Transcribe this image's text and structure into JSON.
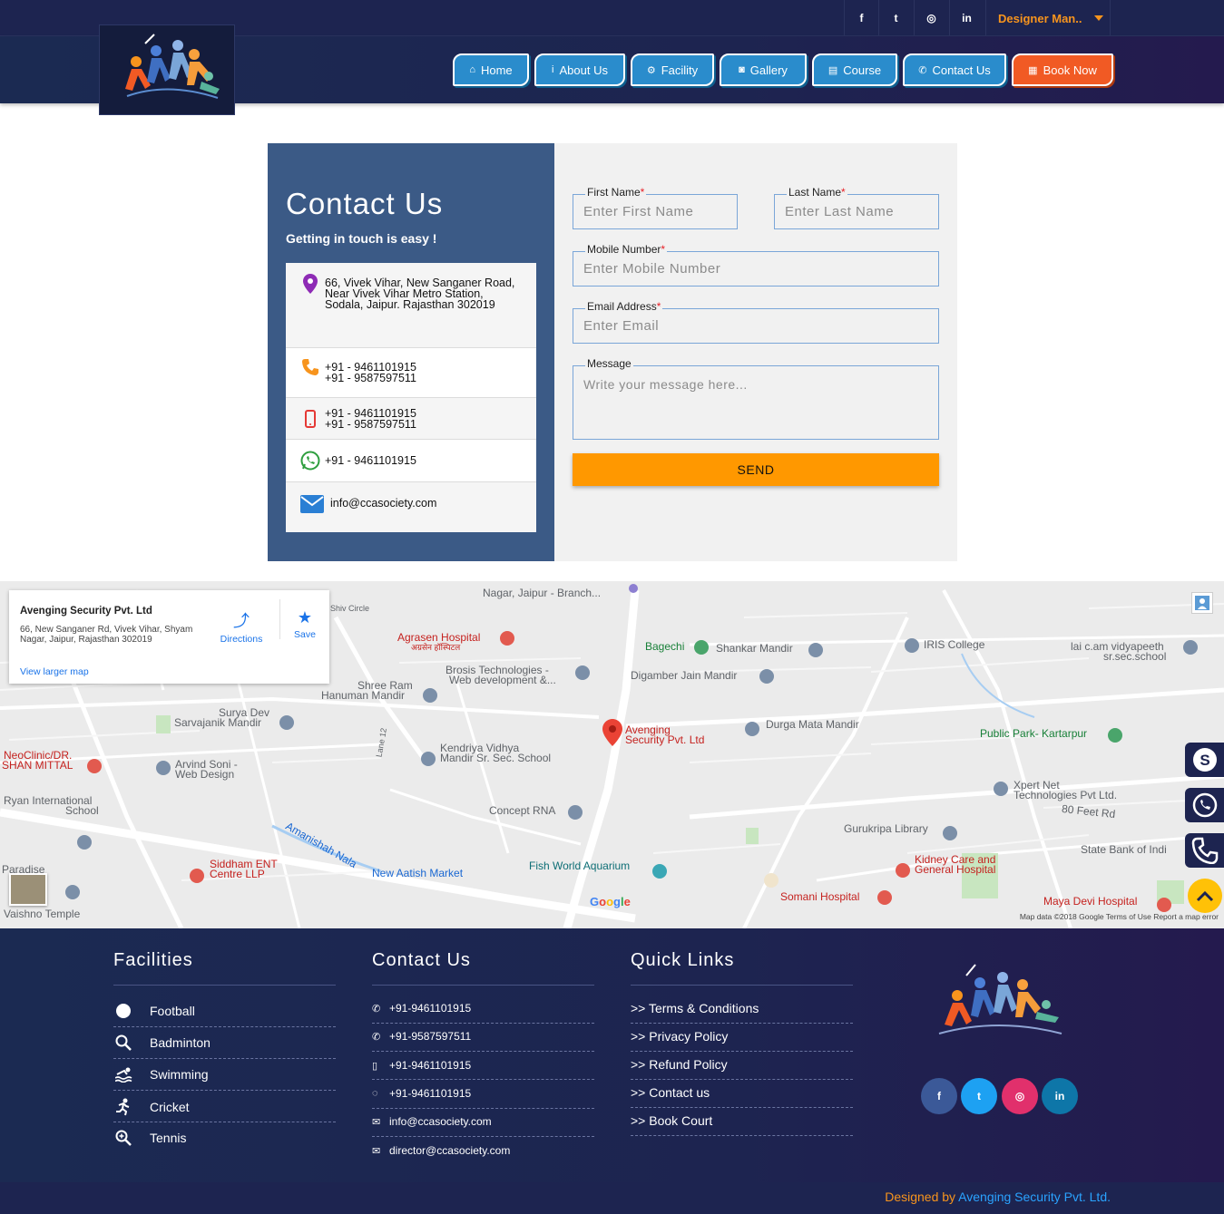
{
  "header": {
    "social": [
      {
        "name": "facebook",
        "glyph": "f"
      },
      {
        "name": "twitter",
        "glyph": "t"
      },
      {
        "name": "instagram",
        "glyph": "◎"
      },
      {
        "name": "linkedin",
        "glyph": "in"
      }
    ],
    "language": "Designer Man..",
    "nav": [
      {
        "label": "Home",
        "icon": "home-icon",
        "glyph": "⌂"
      },
      {
        "label": "About Us",
        "icon": "info-icon",
        "glyph": "i"
      },
      {
        "label": "Facility",
        "icon": "gears-icon",
        "glyph": "⚙"
      },
      {
        "label": "Gallery",
        "icon": "camera-icon",
        "glyph": "◙"
      },
      {
        "label": "Course",
        "icon": "book-icon",
        "glyph": "▤"
      },
      {
        "label": "Contact Us",
        "icon": "phone-icon",
        "glyph": "✆"
      },
      {
        "label": "Book Now",
        "icon": "calendar-check-icon",
        "glyph": "▦"
      }
    ],
    "colors": {
      "nav_blue": "#2a8ccc",
      "book_orange": "#f15a24",
      "dark_navy": "#1d2450"
    }
  },
  "contact_panel": {
    "title": "Contact Us",
    "subtitle": "Getting in touch is easy !",
    "address": [
      "66, Vivek Vihar, New Sanganer Road,",
      "Near Vivek Vihar Metro Station,",
      "Sodala, Jaipur. Rajasthan 302019"
    ],
    "phones": [
      "+91 - 9461101915",
      "+91 - 9587597511"
    ],
    "mobiles": [
      "+91 - 9461101915",
      "+91 - 9587597511"
    ],
    "whatsapp": "+91 - 9461101915",
    "email": "info@ccasociety.com"
  },
  "form": {
    "first_name": {
      "label": "First Name",
      "required": "*",
      "placeholder": "Enter First Name"
    },
    "last_name": {
      "label": "Last Name",
      "required": "*",
      "placeholder": "Enter Last Name"
    },
    "mobile": {
      "label": "Mobile Number",
      "required": "*",
      "placeholder": "Enter Mobile Number"
    },
    "email": {
      "label": "Email Address",
      "required": "*",
      "placeholder": "Enter Email"
    },
    "message": {
      "label": "Message",
      "placeholder": "Write your message here..."
    },
    "send": "SEND"
  },
  "map": {
    "card": {
      "title": "Avenging Security Pvt. Ltd",
      "address": "66, New Sanganer Rd, Vivek Vihar, Shyam Nagar, Jaipur, Rajasthan 302019",
      "directions": "Directions",
      "save": "Save",
      "view_larger": "View larger map"
    },
    "pin_label": [
      "Avenging",
      "Security Pvt. Ltd"
    ],
    "places": [
      {
        "text": "Nagar, Jaipur - Branch...",
        "cls": ""
      },
      {
        "text": "Agrasen Hospital",
        "cls": "red"
      },
      {
        "text": "अग्रसेन हॉस्पिटल",
        "cls": "red small"
      },
      {
        "text": "Bagechi",
        "cls": "green"
      },
      {
        "text": "Shankar Mandir",
        "cls": ""
      },
      {
        "text": "IRIS College",
        "cls": ""
      },
      {
        "text": "lai c.am vidyapeeth",
        "cls": ""
      },
      {
        "text": "sr.sec.school",
        "cls": ""
      },
      {
        "text": "Brosis Technologies -",
        "cls": ""
      },
      {
        "text": "Web development &...",
        "cls": ""
      },
      {
        "text": "Digamber Jain Mandir",
        "cls": ""
      },
      {
        "text": "Shree Ram",
        "cls": ""
      },
      {
        "text": "Hanuman Mandir",
        "cls": ""
      },
      {
        "text": "Surya Dev",
        "cls": ""
      },
      {
        "text": "Sarvajanik Mandir",
        "cls": ""
      },
      {
        "text": "Durga Mata Mandir",
        "cls": ""
      },
      {
        "text": "Public Park- Kartarpur",
        "cls": "green"
      },
      {
        "text": "NeoClinic/DR.",
        "cls": "red"
      },
      {
        "text": "SHAN MITTAL",
        "cls": "red"
      },
      {
        "text": "Arvind Soni -",
        "cls": ""
      },
      {
        "text": "Web Design",
        "cls": ""
      },
      {
        "text": "Kendriya Vidhya",
        "cls": ""
      },
      {
        "text": "Mandir Sr. Sec. School",
        "cls": ""
      },
      {
        "text": "Ryan International",
        "cls": ""
      },
      {
        "text": "School",
        "cls": ""
      },
      {
        "text": "Xpert Net",
        "cls": ""
      },
      {
        "text": "Technologies Pvt Ltd.",
        "cls": ""
      },
      {
        "text": "80 Feet Rd",
        "cls": ""
      },
      {
        "text": "Concept RNA",
        "cls": ""
      },
      {
        "text": "Gurukripa Library",
        "cls": ""
      },
      {
        "text": "State Bank of Indi",
        "cls": ""
      },
      {
        "text": "Kidney Care and",
        "cls": "red"
      },
      {
        "text": "General Hospital",
        "cls": "red"
      },
      {
        "text": "Siddham ENT",
        "cls": "red"
      },
      {
        "text": "Centre LLP",
        "cls": "red"
      },
      {
        "text": "New Aatish Market",
        "cls": "blue"
      },
      {
        "text": "Fish World Aquarium",
        "cls": "teal"
      },
      {
        "text": "Somani Hospital",
        "cls": "red"
      },
      {
        "text": "Maya Devi Hospital",
        "cls": "red"
      },
      {
        "text": "Paradise",
        "cls": ""
      },
      {
        "text": "Vaishno Temple",
        "cls": ""
      },
      {
        "text": "Amanishah Nala",
        "cls": "blue"
      },
      {
        "text": "Shiv Circle",
        "cls": "small"
      },
      {
        "text": "Lane 12",
        "cls": "small"
      }
    ],
    "credit": "Map data ©2018 Google   Terms of Use   Report a map error",
    "google": "Google"
  },
  "footer": {
    "facilities": {
      "title": "Facilities",
      "items": [
        {
          "label": "Football",
          "icon": "football-icon"
        },
        {
          "label": "Badminton",
          "icon": "search-icon"
        },
        {
          "label": "Swimming",
          "icon": "swimmer-icon"
        },
        {
          "label": "Cricket",
          "icon": "runner-icon"
        },
        {
          "label": "Tennis",
          "icon": "search-plus-icon"
        }
      ]
    },
    "contact": {
      "title": "Contact Us",
      "items": [
        {
          "label": "+91-9461101915",
          "icon": "phone-icon",
          "glyph": "✆"
        },
        {
          "label": "+91-9587597511",
          "icon": "phone-icon",
          "glyph": "✆"
        },
        {
          "label": "+91-9461101915",
          "icon": "mobile-icon",
          "glyph": "▯"
        },
        {
          "label": "+91-9461101915",
          "icon": "whatsapp-icon",
          "glyph": "◌"
        },
        {
          "label": "info@ccasociety.com",
          "icon": "envelope-icon",
          "glyph": "✉"
        },
        {
          "label": "director@ccasociety.com",
          "icon": "envelope-icon",
          "glyph": "✉"
        }
      ]
    },
    "quick_links": {
      "title": "Quick Links",
      "items": [
        ">> Terms & Conditions",
        ">> Privacy Policy",
        ">> Refund Policy",
        ">> Contact us",
        ">> Book Court"
      ]
    },
    "social": [
      {
        "name": "facebook",
        "glyph": "f",
        "color": "#3b5998"
      },
      {
        "name": "twitter",
        "glyph": "t",
        "color": "#1da1f2"
      },
      {
        "name": "instagram",
        "glyph": "◎",
        "color": "#e1306c"
      },
      {
        "name": "linkedin",
        "glyph": "in",
        "color": "#0e76a8"
      }
    ],
    "designed_by": "Designed by",
    "company": "Avenging Security Pvt. Ltd."
  }
}
